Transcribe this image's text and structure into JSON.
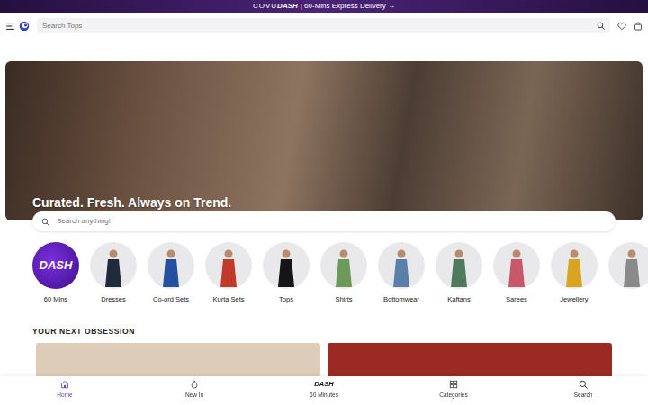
{
  "banner": {
    "logo": [
      "COVU",
      "DASH"
    ],
    "text": "| 60-Mins Express Delivery →"
  },
  "header": {
    "search": {
      "placeholder": "Search Tops"
    }
  },
  "hero": {
    "headline": "Curated. Fresh. Always on Trend."
  },
  "search": {
    "placeholder": "Search anything!"
  },
  "categories": [
    {
      "label": "60 Mins",
      "kind": "dash",
      "badge": "DASH"
    },
    {
      "label": "Dresses",
      "kind": "photo",
      "color": "#1f2a3a"
    },
    {
      "label": "Co-ord Sets",
      "kind": "photo",
      "color": "#2350a0"
    },
    {
      "label": "Kurta Sets",
      "kind": "photo",
      "color": "#c0392b"
    },
    {
      "label": "Tops",
      "kind": "photo",
      "color": "#151515"
    },
    {
      "label": "Shirts",
      "kind": "photo",
      "color": "#6d9a5a"
    },
    {
      "label": "Bottomwear",
      "kind": "photo",
      "color": "#5a7fa8"
    },
    {
      "label": "Kaftans",
      "kind": "photo",
      "color": "#4f7a5e"
    },
    {
      "label": "Sarees",
      "kind": "photo",
      "color": "#c8576a"
    },
    {
      "label": "Jewellery",
      "kind": "photo",
      "color": "#d9a520"
    },
    {
      "label": "",
      "kind": "partial",
      "color": "#8a8a8a"
    }
  ],
  "section": {
    "title": "YOUR NEXT OBSESSION"
  },
  "products": [
    {
      "kind": "photo",
      "color": "#dcccb8"
    },
    {
      "kind": "photo",
      "color": "#9a2a22"
    }
  ],
  "bottom_nav": [
    {
      "label": "Home",
      "selected": true,
      "kind": "home"
    },
    {
      "label": "New In",
      "selected": false,
      "kind": "newin"
    },
    {
      "label": "60 Minutes",
      "selected": false,
      "kind": "dash",
      "badge": "DASH"
    },
    {
      "label": "Categories",
      "selected": false,
      "kind": "grid"
    },
    {
      "label": "Search",
      "selected": false,
      "kind": "search"
    }
  ]
}
